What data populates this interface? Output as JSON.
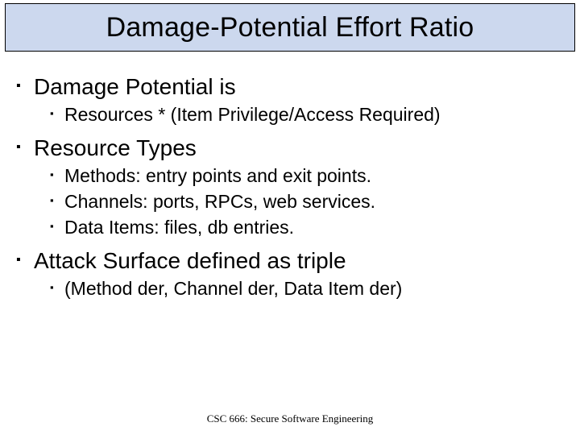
{
  "title": "Damage-Potential Effort Ratio",
  "items": [
    {
      "label": "Damage Potential is",
      "children": [
        {
          "label": "Resources * (Item Privilege/Access Required)"
        }
      ]
    },
    {
      "label": "Resource Types",
      "children": [
        {
          "label": "Methods: entry points and exit points."
        },
        {
          "label": "Channels: ports, RPCs, web services."
        },
        {
          "label": "Data Items: files, db entries."
        }
      ]
    },
    {
      "label": "Attack Surface defined as triple",
      "children": [
        {
          "label": "(Method der, Channel der, Data Item der)"
        }
      ]
    }
  ],
  "footer": "CSC 666: Secure Software Engineering"
}
